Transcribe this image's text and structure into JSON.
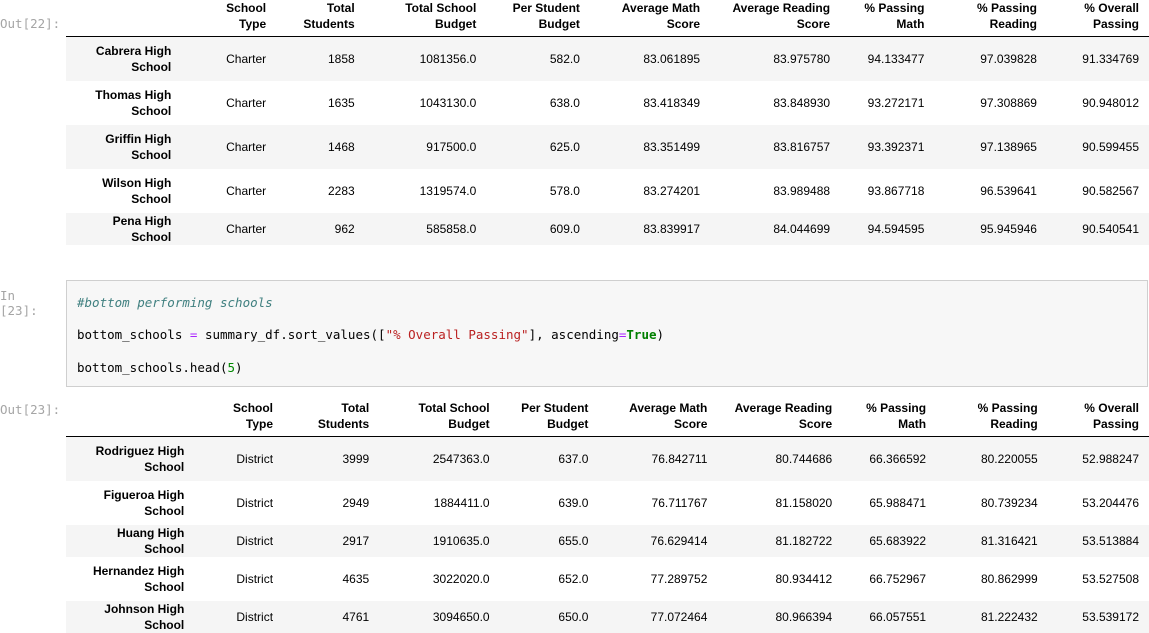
{
  "prompts": {
    "out22": "Out[22]:",
    "in23": "In [23]:",
    "out23": "Out[23]:"
  },
  "columns": [
    [
      "School",
      "Type"
    ],
    [
      "Total",
      "Students"
    ],
    [
      "Total School",
      "Budget"
    ],
    [
      "Per Student",
      "Budget"
    ],
    [
      "Average Math",
      "Score"
    ],
    [
      "Average Reading",
      "Score"
    ],
    [
      "% Passing",
      "Math"
    ],
    [
      "% Passing",
      "Reading"
    ],
    [
      "% Overall",
      "Passing"
    ]
  ],
  "top_table": {
    "rows": [
      {
        "name": [
          "Cabrera High",
          "School"
        ],
        "cells": [
          "Charter",
          "1858",
          "1081356.0",
          "582.0",
          "83.061895",
          "83.975780",
          "94.133477",
          "97.039828",
          "91.334769"
        ]
      },
      {
        "name": [
          "Thomas High",
          "School"
        ],
        "cells": [
          "Charter",
          "1635",
          "1043130.0",
          "638.0",
          "83.418349",
          "83.848930",
          "93.272171",
          "97.308869",
          "90.948012"
        ]
      },
      {
        "name": [
          "Griffin High",
          "School"
        ],
        "cells": [
          "Charter",
          "1468",
          "917500.0",
          "625.0",
          "83.351499",
          "83.816757",
          "93.392371",
          "97.138965",
          "90.599455"
        ]
      },
      {
        "name": [
          "Wilson High",
          "School"
        ],
        "cells": [
          "Charter",
          "2283",
          "1319574.0",
          "578.0",
          "83.274201",
          "83.989488",
          "93.867718",
          "96.539641",
          "90.582567"
        ]
      },
      {
        "name": [
          "Pena High School"
        ],
        "cells": [
          "Charter",
          "962",
          "585858.0",
          "609.0",
          "83.839917",
          "84.044699",
          "94.594595",
          "95.945946",
          "90.540541"
        ]
      }
    ]
  },
  "code": {
    "comment": "#bottom performing schools",
    "line2_var": "bottom_schools",
    "line2_eq": " = ",
    "line2_call": "summary_df.sort_values([",
    "line2_str": "\"% Overall Passing\"",
    "line2_mid": "], ascending",
    "line2_eq2": "=",
    "line2_kw": "True",
    "line2_end": ")",
    "line3_call": "bottom_schools.head(",
    "line3_num": "5",
    "line3_end": ")"
  },
  "bottom_table": {
    "rows": [
      {
        "name": [
          "Rodriguez High",
          "School"
        ],
        "cells": [
          "District",
          "3999",
          "2547363.0",
          "637.0",
          "76.842711",
          "80.744686",
          "66.366592",
          "80.220055",
          "52.988247"
        ]
      },
      {
        "name": [
          "Figueroa High",
          "School"
        ],
        "cells": [
          "District",
          "2949",
          "1884411.0",
          "639.0",
          "76.711767",
          "81.158020",
          "65.988471",
          "80.739234",
          "53.204476"
        ]
      },
      {
        "name": [
          "Huang High School"
        ],
        "cells": [
          "District",
          "2917",
          "1910635.0",
          "655.0",
          "76.629414",
          "81.182722",
          "65.683922",
          "81.316421",
          "53.513884"
        ]
      },
      {
        "name": [
          "Hernandez High",
          "School"
        ],
        "cells": [
          "District",
          "4635",
          "3022020.0",
          "652.0",
          "77.289752",
          "80.934412",
          "66.752967",
          "80.862999",
          "53.527508"
        ]
      },
      {
        "name": [
          "Johnson High School"
        ],
        "cells": [
          "District",
          "4761",
          "3094650.0",
          "650.0",
          "77.072464",
          "80.966394",
          "66.057551",
          "81.222432",
          "53.539172"
        ]
      }
    ]
  }
}
